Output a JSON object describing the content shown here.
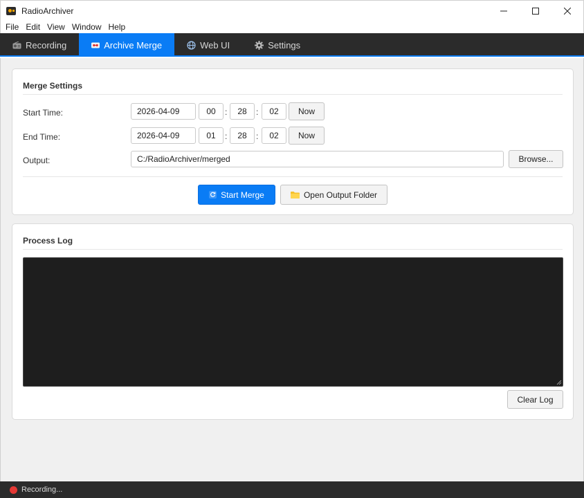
{
  "window": {
    "title": "RadioArchiver"
  },
  "menu": {
    "items": [
      "File",
      "Edit",
      "View",
      "Window",
      "Help"
    ]
  },
  "tabs": [
    {
      "label": "Recording",
      "icon": "radio-icon",
      "active": false
    },
    {
      "label": "Archive Merge",
      "icon": "cassette-icon",
      "active": true
    },
    {
      "label": "Web UI",
      "icon": "globe-icon",
      "active": false
    },
    {
      "label": "Settings",
      "icon": "gear-icon",
      "active": false
    }
  ],
  "merge": {
    "title": "Merge Settings",
    "start": {
      "label": "Start Time:",
      "date": "2026-04-09",
      "hour": "00",
      "minute": "28",
      "second": "02",
      "now_label": "Now"
    },
    "end": {
      "label": "End Time:",
      "date": "2026-04-09",
      "hour": "01",
      "minute": "28",
      "second": "02",
      "now_label": "Now"
    },
    "output": {
      "label": "Output:",
      "value": "C:/RadioArchiver/merged",
      "browse_label": "Browse..."
    },
    "colon": ":",
    "start_button": "Start Merge",
    "open_folder_button": "Open Output Folder"
  },
  "log": {
    "title": "Process Log",
    "content": "",
    "clear_label": "Clear Log"
  },
  "status": {
    "text": "Recording...",
    "color": "#e53935"
  },
  "colors": {
    "accent": "#0a7cf5",
    "tabbar": "#2b2b2b",
    "log_bg": "#1e1e1e"
  }
}
